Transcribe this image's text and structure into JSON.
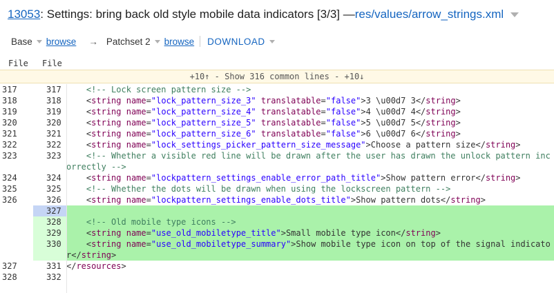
{
  "header": {
    "change_number": "13053",
    "subject": ": Settings: bring back old style mobile data indicators [3/3] — ",
    "file_path": "res/values/arrow_strings.xml"
  },
  "patchbar": {
    "base_label": "Base",
    "browse_label": "browse",
    "arrow": "→",
    "patchset_label": "Patchset 2",
    "download_label": "DOWNLOAD"
  },
  "columns": {
    "left": "File",
    "right": "File"
  },
  "common_lines": "+10↑ - Show 316 common lines - +10↓",
  "rows": [
    {
      "l": "317",
      "r": "317",
      "code": "    <!-- Lock screen pattern size -->"
    },
    {
      "l": "318",
      "r": "318",
      "code": "    <string name=\"lock_pattern_size_3\" translatable=\"false\">3 \\u00d7 3</string>"
    },
    {
      "l": "319",
      "r": "319",
      "code": "    <string name=\"lock_pattern_size_4\" translatable=\"false\">4 \\u00d7 4</string>"
    },
    {
      "l": "320",
      "r": "320",
      "code": "    <string name=\"lock_pattern_size_5\" translatable=\"false\">5 \\u00d7 5</string>"
    },
    {
      "l": "321",
      "r": "321",
      "code": "    <string name=\"lock_pattern_size_6\" translatable=\"false\">6 \\u00d7 6</string>"
    },
    {
      "l": "322",
      "r": "322",
      "code": "    <string name=\"lock_settings_picker_pattern_size_message\">Choose a pattern size</string>"
    },
    {
      "l": "323",
      "r": "323",
      "code": "    <!-- Whether a visible red line will be drawn after the user has drawn the unlock pattern incorrectly -->",
      "wrap": true
    },
    {
      "l": "324",
      "r": "324",
      "code": "    <string name=\"lockpattern_settings_enable_error_path_title\">Show pattern error</string>"
    },
    {
      "l": "325",
      "r": "325",
      "code": "    <!-- Whether the dots will be drawn when using the lockscreen pattern -->"
    },
    {
      "l": "326",
      "r": "326",
      "code": "    <string name=\"lockpattern_settings_enable_dots_title\">Show pattern dots</string>"
    },
    {
      "l": "",
      "r": "327",
      "code": "",
      "added": true,
      "focus": true
    },
    {
      "l": "",
      "r": "328",
      "code": "    <!-- Old mobile type icons -->",
      "added": true
    },
    {
      "l": "",
      "r": "329",
      "code": "    <string name=\"use_old_mobiletype_title\">Small mobile type icon</string>",
      "added": true
    },
    {
      "l": "",
      "r": "330",
      "code": "    <string name=\"use_old_mobiletype_summary\">Show mobile type icon on top of the signal indicator</string>",
      "added": true,
      "wrap": true
    },
    {
      "l": "327",
      "r": "331",
      "code": "</resources>"
    },
    {
      "l": "328",
      "r": "332",
      "code": ""
    }
  ]
}
